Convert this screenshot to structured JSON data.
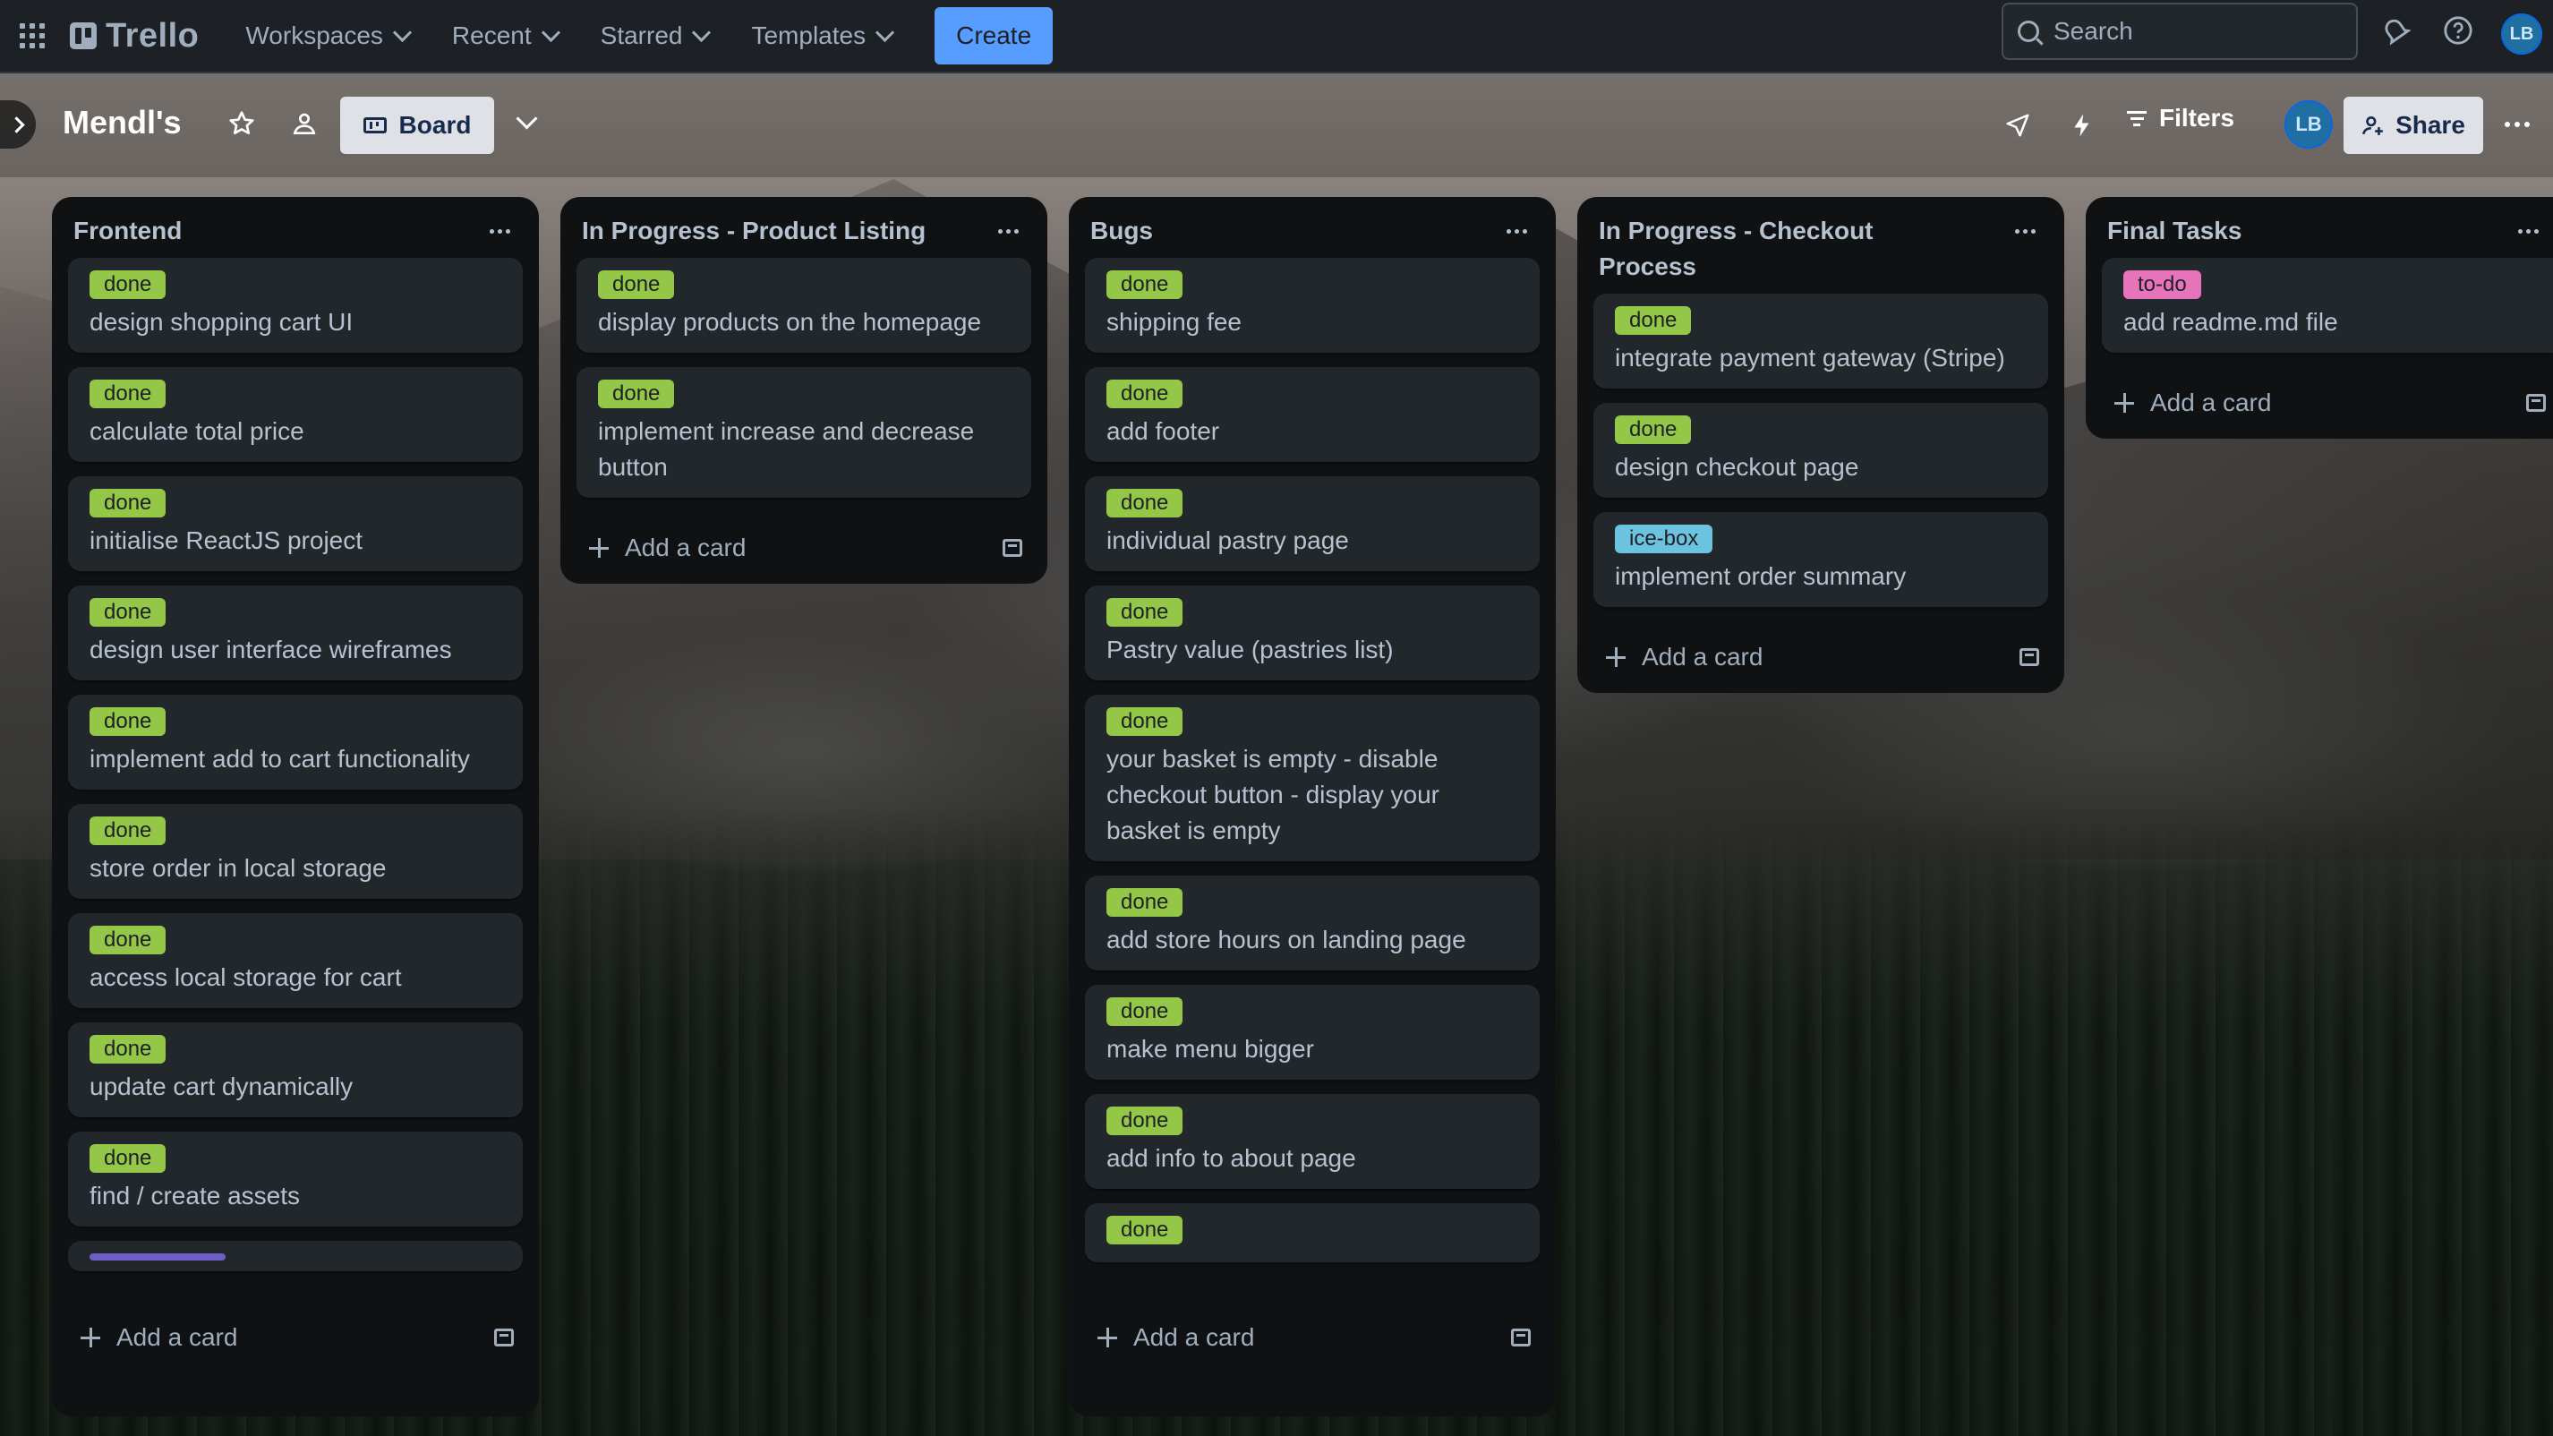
{
  "app": {
    "name": "Trello"
  },
  "nav": {
    "items": [
      {
        "label": "Workspaces"
      },
      {
        "label": "Recent"
      },
      {
        "label": "Starred"
      },
      {
        "label": "Templates"
      }
    ],
    "create_label": "Create"
  },
  "search": {
    "placeholder": "Search"
  },
  "user": {
    "initials": "LB"
  },
  "board": {
    "title": "Mendl's",
    "view_label": "Board",
    "filters_label": "Filters",
    "share_label": "Share"
  },
  "colors": {
    "done": "#7ee2b8",
    "done_alt": "#94c748",
    "todo": "#e774bb",
    "icebox": "#6cc3e0",
    "create": "#579dff"
  },
  "lists": [
    {
      "title": "Frontend",
      "cards": [
        {
          "label": "done",
          "title": "design shopping cart UI"
        },
        {
          "label": "done",
          "title": "calculate total price"
        },
        {
          "label": "done",
          "title": "initialise ReactJS project"
        },
        {
          "label": "done",
          "title": "design user interface wireframes"
        },
        {
          "label": "done",
          "title": "implement add to cart functionality"
        },
        {
          "label": "done",
          "title": "store order in local storage"
        },
        {
          "label": "done",
          "title": "access local storage for cart"
        },
        {
          "label": "done",
          "title": "update cart dynamically"
        },
        {
          "label": "done",
          "title": "find / create assets"
        }
      ],
      "add_label": "Add a card"
    },
    {
      "title": "In Progress - Product Listing",
      "cards": [
        {
          "label": "done",
          "title": "display products on the homepage"
        },
        {
          "label": "done",
          "title": "implement increase and decrease button"
        }
      ],
      "add_label": "Add a card"
    },
    {
      "title": "Bugs",
      "cards": [
        {
          "label": "done",
          "title": "shipping fee"
        },
        {
          "label": "done",
          "title": "add footer"
        },
        {
          "label": "done",
          "title": "individual pastry page"
        },
        {
          "label": "done",
          "title": "Pastry value (pastries list)"
        },
        {
          "label": "done",
          "title": "your basket is empty - disable checkout button - display your basket is empty"
        },
        {
          "label": "done",
          "title": "add store hours on landing page"
        },
        {
          "label": "done",
          "title": "make menu bigger"
        },
        {
          "label": "done",
          "title": "add info to about page"
        },
        {
          "label": "done",
          "title": ""
        }
      ],
      "add_label": "Add a card"
    },
    {
      "title": "In Progress - Checkout Process",
      "cards": [
        {
          "label": "done",
          "title": "integrate payment gateway (Stripe)"
        },
        {
          "label": "done",
          "title": "design checkout page"
        },
        {
          "label": "ice-box",
          "title": "implement order summary"
        }
      ],
      "add_label": "Add a card"
    },
    {
      "title": "Final Tasks",
      "cards": [
        {
          "label": "to-do",
          "title": "add readme.md file"
        }
      ],
      "add_label": "Add a card"
    }
  ]
}
